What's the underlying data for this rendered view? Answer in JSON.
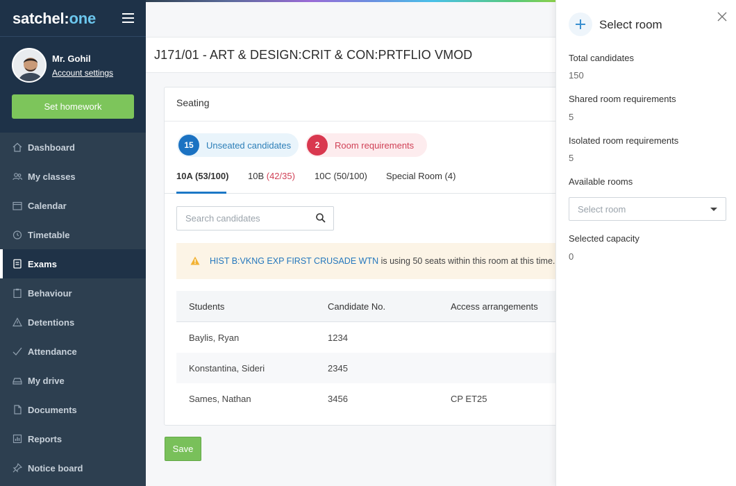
{
  "app": {
    "logo_main": "satchel:",
    "logo_accent": "one"
  },
  "user": {
    "name": "Mr. Gohil",
    "account_link": "Account settings"
  },
  "sidebar": {
    "homework_button": "Set homework",
    "items": [
      {
        "label": "Dashboard",
        "icon": "home-icon"
      },
      {
        "label": "My classes",
        "icon": "users-icon"
      },
      {
        "label": "Calendar",
        "icon": "calendar-icon"
      },
      {
        "label": "Timetable",
        "icon": "clock-icon"
      },
      {
        "label": "Exams",
        "icon": "exam-icon",
        "active": true
      },
      {
        "label": "Behaviour",
        "icon": "clipboard-icon"
      },
      {
        "label": "Detentions",
        "icon": "warning-icon"
      },
      {
        "label": "Attendance",
        "icon": "check-icon"
      },
      {
        "label": "My drive",
        "icon": "drive-icon"
      },
      {
        "label": "Documents",
        "icon": "document-icon"
      },
      {
        "label": "Reports",
        "icon": "report-icon"
      },
      {
        "label": "Notice board",
        "icon": "pin-icon"
      }
    ]
  },
  "main": {
    "title": "J171/01 - ART & DESIGN:CRIT & CON:PRTFLIO VMOD",
    "card_title": "Seating",
    "pills": {
      "unseated_count": "15",
      "unseated_label": "Unseated candidates",
      "requirements_count": "2",
      "requirements_label": "Room requirements"
    },
    "tabs": [
      {
        "label": "10A (53/100)"
      },
      {
        "label": "10B ",
        "warn": "(42/35)"
      },
      {
        "label": "10C (50/100)"
      },
      {
        "label": "Special Room (4)"
      }
    ],
    "search_placeholder": "Search candidates",
    "alert": {
      "link": "HIST B:VKNG EXP FIRST CRUSADE WTN",
      "text": " is using 50 seats within this room at this time."
    },
    "table": {
      "headers": [
        "Students",
        "Candidate No.",
        "Access arrangements"
      ],
      "rows": [
        [
          "Baylis, Ryan",
          "1234",
          ""
        ],
        [
          "Konstantina, Sideri",
          "2345",
          ""
        ],
        [
          "Sames, Nathan",
          "3456",
          "CP ET25"
        ]
      ]
    },
    "save_button": "Save"
  },
  "panel": {
    "title": "Select room",
    "total_label": "Total candidates",
    "total_value": "150",
    "shared_label": "Shared room requirements",
    "shared_value": "5",
    "isolated_label": "Isolated room requirements",
    "isolated_value": "5",
    "available_label": "Available rooms",
    "room_placeholder": "Select room",
    "capacity_label": "Selected capacity",
    "capacity_value": "0"
  },
  "colors": {
    "sidebar_bg": "#2d3f50",
    "sidebar_header_bg": "#1e3248",
    "accent_green": "#7dc55b",
    "accent_blue": "#1b72c2",
    "accent_red": "#d9384f"
  }
}
